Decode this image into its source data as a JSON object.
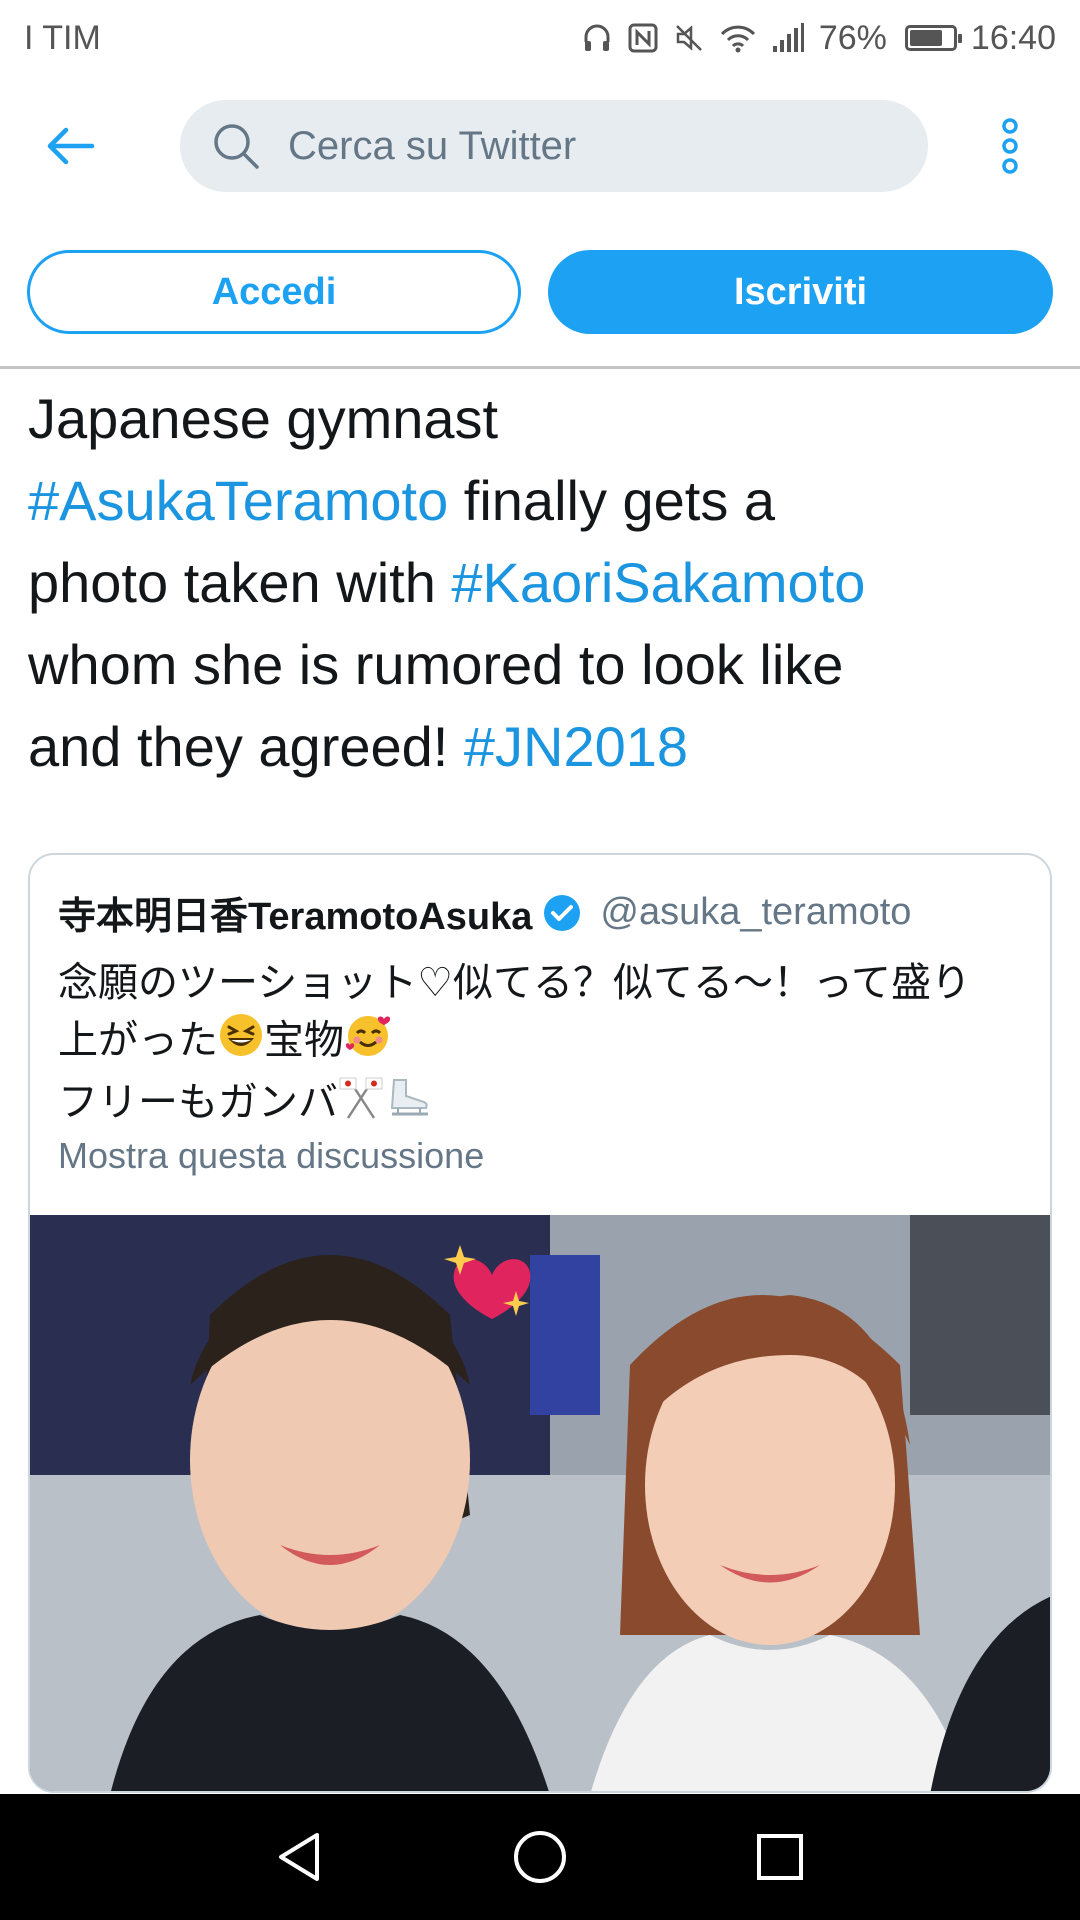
{
  "status_bar": {
    "carrier": "I TIM",
    "battery": "76%",
    "battery_level": 0.76,
    "time": "16:40",
    "icons": [
      "headphones-icon",
      "nfc-icon",
      "mute-icon",
      "wifi-icon",
      "signal-icon",
      "battery-icon"
    ]
  },
  "header": {
    "back_icon": "arrow-left-icon",
    "search_placeholder": "Cerca su Twitter",
    "search_icon": "search-icon",
    "more_icon": "more-vertical-icon"
  },
  "auth": {
    "login_label": "Accedi",
    "signup_label": "Iscriviti"
  },
  "tweet": {
    "text_1": "Japanese gymnast",
    "tag_1": "#AsukaTeramoto",
    "text_2": " finally gets a",
    "text_3": "photo taken with ",
    "tag_2": "#KaoriSakamoto",
    "text_4": "whom she is rumored to look like",
    "text_5": "and they agreed! ",
    "tag_3": "#JN2018"
  },
  "quoted_tweet": {
    "display_name": "寺本明日香TeramotoAsuka",
    "handle": "@asuka_teramoto",
    "verified_icon": "verified-badge-icon",
    "line_1": "念願のツーショット♡似てる？似てる〜！って盛り",
    "line_2a": "上がった",
    "line_2b": "宝物",
    "line_3": "フリーもガンバ",
    "emojis": [
      "grinning-squinting-face-icon",
      "smiling-face-with-hearts-icon",
      "crossed-flags-icon",
      "ice-skate-icon"
    ],
    "show_thread": "Mostra questa discussione",
    "photo": "selfie-photo"
  },
  "nav": {
    "back": "triangle-back-icon",
    "home": "circle-home-icon",
    "recents": "square-recents-icon"
  },
  "colors": {
    "accent": "#1da1f2",
    "link": "#1b95e0",
    "muted": "#657786",
    "border": "#ccd6dd"
  }
}
